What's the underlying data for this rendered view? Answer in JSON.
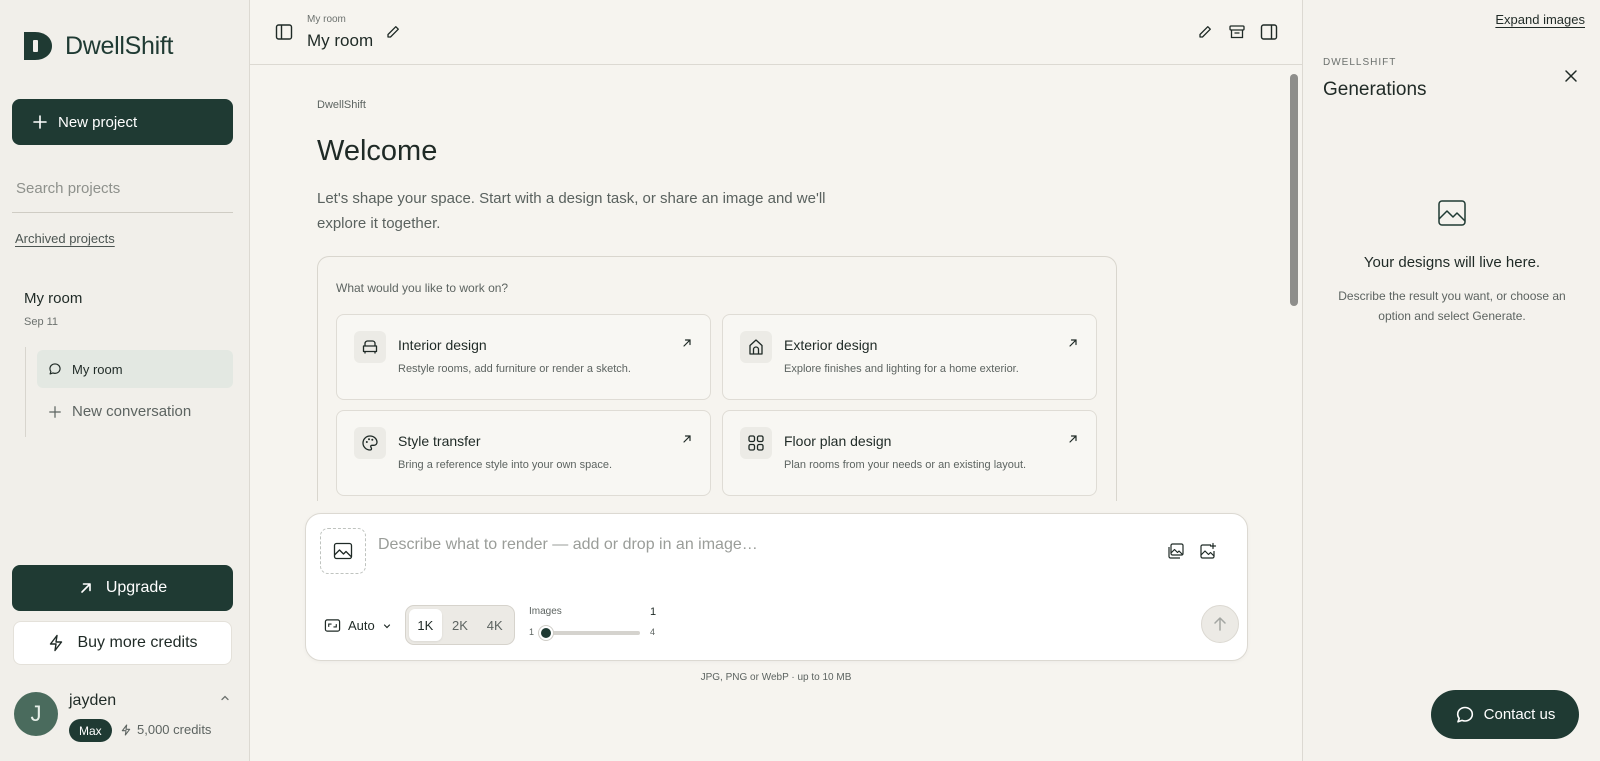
{
  "brand": {
    "name": "DwellShift"
  },
  "sidebar": {
    "new_project_label": "New project",
    "search_placeholder": "Search projects",
    "archived_label": "Archived projects",
    "project": {
      "title": "My room",
      "date": "Sep 11"
    },
    "conversations": [
      {
        "label": "My room",
        "active": true
      }
    ],
    "new_conversation_label": "New conversation",
    "upgrade_label": "Upgrade",
    "buy_credits_label": "Buy more credits",
    "user": {
      "initial": "J",
      "name": "jayden",
      "plan": "Max",
      "credits": "5,000 credits"
    }
  },
  "header": {
    "breadcrumb": "My room",
    "title": "My room"
  },
  "main": {
    "eyebrow": "DwellShift",
    "heading": "Welcome",
    "intro": "Let's shape your space. Start with a design task, or share an image and we'll explore it together.",
    "tasks_question": "What would you like to work on?",
    "tasks": [
      {
        "title": "Interior design",
        "desc": "Restyle rooms, add furniture or render a sketch.",
        "icon": "armchair-icon"
      },
      {
        "title": "Exterior design",
        "desc": "Explore finishes and lighting for a home exterior.",
        "icon": "house-icon"
      },
      {
        "title": "Style transfer",
        "desc": "Bring a reference style into your own space.",
        "icon": "palette-icon"
      },
      {
        "title": "Floor plan design",
        "desc": "Plan rooms from your needs or an existing layout.",
        "icon": "layout-grid-icon"
      }
    ]
  },
  "composer": {
    "placeholder": "Describe what to render — add or drop in an image…",
    "aspect_label": "Auto",
    "resolutions": [
      "1K",
      "2K",
      "4K"
    ],
    "selected_resolution": "1K",
    "images_label": "Images",
    "images_value": "1",
    "images_min": "1",
    "images_max": "4",
    "file_hint": "JPG, PNG or WebP · up to 10 MB"
  },
  "right_panel": {
    "expand_label": "Expand images",
    "eyebrow": "DWELLSHIFT",
    "title": "Generations",
    "empty_title": "Your designs will live here.",
    "empty_desc": "Describe the result you want, or choose an option and select Generate."
  },
  "contact_label": "Contact us",
  "colors": {
    "brand_dark": "#1f3a33",
    "background": "#f6f4ef",
    "active_item": "#e3e8e2"
  }
}
